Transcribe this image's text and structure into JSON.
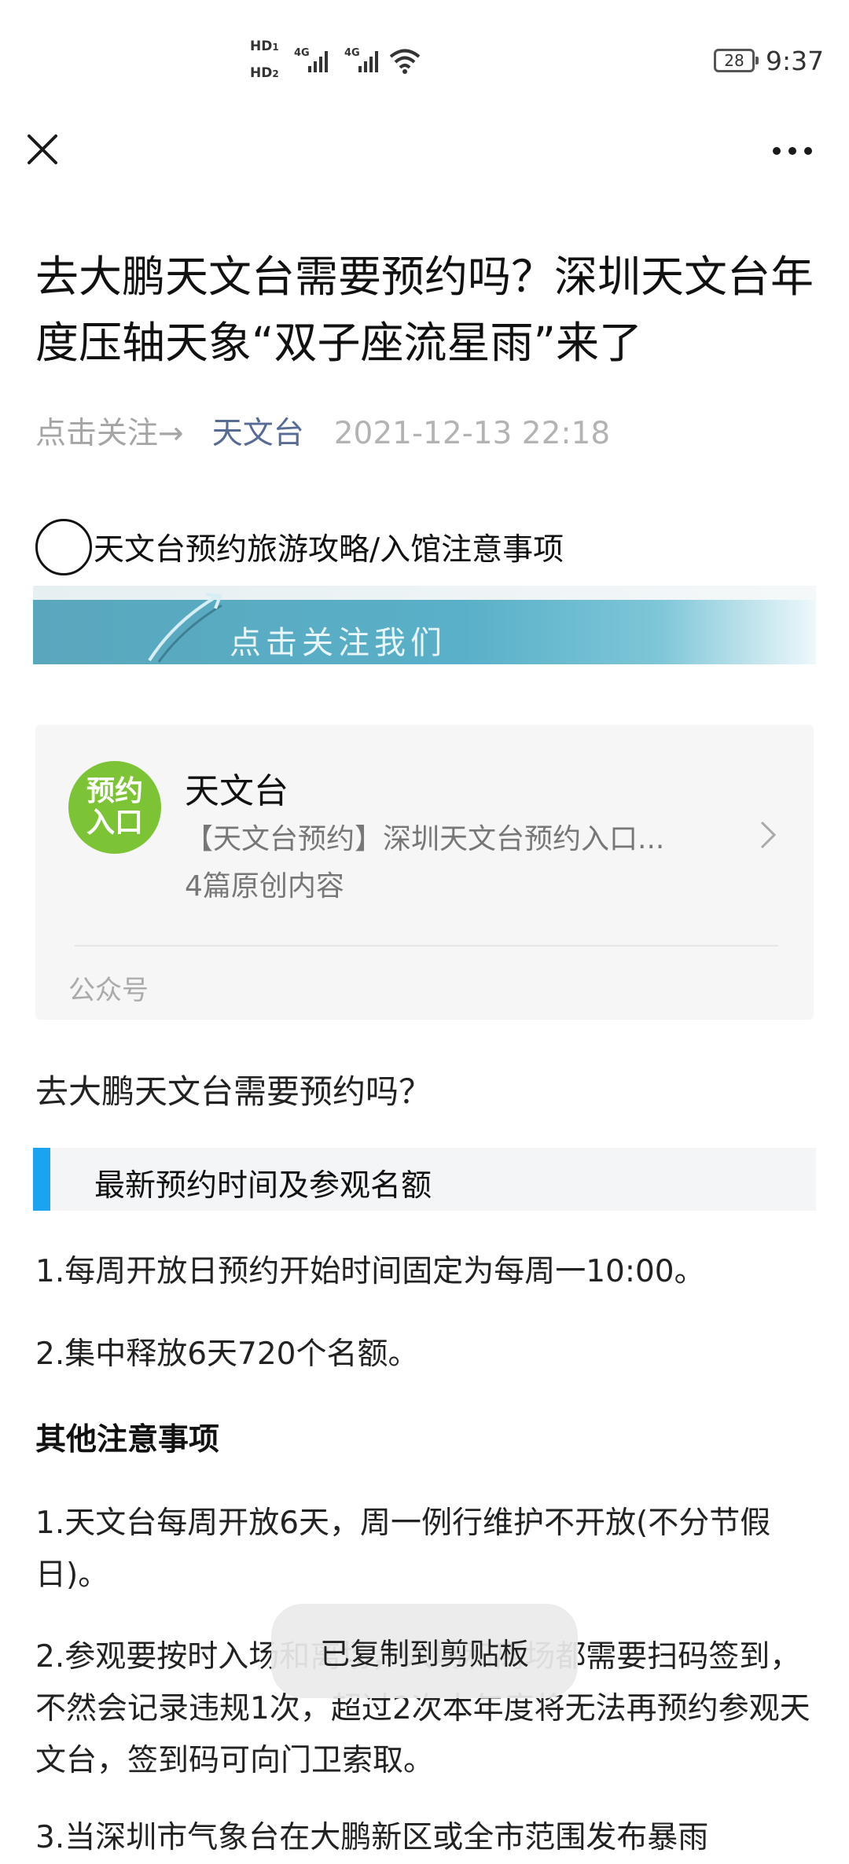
{
  "status_bar": {
    "hd1": "HD",
    "hd1_sub": "1",
    "hd2": "HD",
    "hd2_sub": "2",
    "net1": "4G",
    "net2": "4G",
    "battery": "28",
    "time": "9:37"
  },
  "nav": {
    "close_icon": "close-icon",
    "more_icon": "more-icon"
  },
  "article": {
    "title": "去大鹏天文台需要预约吗？深圳天文台年度压轴天象“双子座流星雨”来了",
    "follow_hint": "点击关注→",
    "author": "天文台",
    "date": "2021-12-13 22:18",
    "guide_line": "天文台预约旅游攻略/入馆注意事项",
    "banner_text": "点击关注我们"
  },
  "card": {
    "logo_line1": "预约",
    "logo_line2": "入口",
    "name": "天文台",
    "desc": "【天文台预约】深圳天文台预约入口...",
    "count": "4篇原创内容",
    "type": "公众号",
    "logo_color": "#7cc436"
  },
  "content": {
    "question": "去大鹏天文台需要预约吗？",
    "section_title": "最新预约时间及参观名额",
    "p1": "1.每周开放日预约开始时间固定为每周一10:00。",
    "p2": "2.集中释放6天720个名额。",
    "heading2": "其他注意事项",
    "p3": "1.天文台每周开放6天，周一例行维护不开放(不分节假日)。",
    "p4": "2.参观要按时入场和离场，入场和离场都需要扫码签到，不然会记录违规1次，超过2次本年度将无法再预约参观天文台，签到码可向门卫索取。",
    "p5": "3.当深圳市气象台在大鹏新区或全市范围发布暴雨"
  },
  "toast": {
    "text": "已复制到剪贴板"
  },
  "colors": {
    "accent_bar": "#1aa3f1",
    "author_link": "#576b95"
  }
}
